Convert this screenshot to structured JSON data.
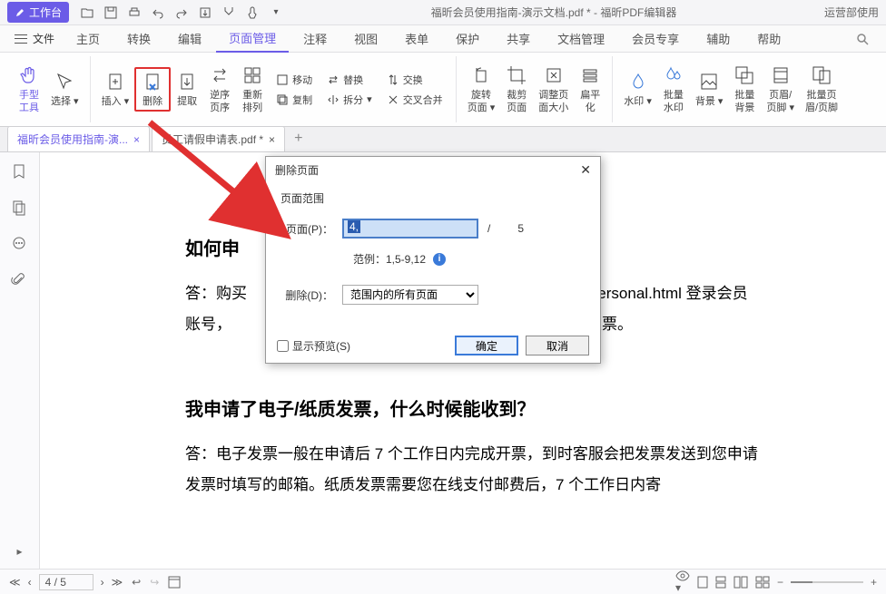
{
  "titlebar": {
    "workspace": "工作台",
    "document_title": "福昕会员使用指南-演示文档.pdf * - 福昕PDF编辑器",
    "right_text": "运营部使用"
  },
  "menu": {
    "file": "文件",
    "items": [
      "主页",
      "转换",
      "编辑",
      "页面管理",
      "注释",
      "视图",
      "表单",
      "保护",
      "共享",
      "文档管理",
      "会员专享",
      "辅助",
      "帮助"
    ],
    "active_index": 3
  },
  "ribbon": {
    "hand_tool": "手型\n工具",
    "select": "选择",
    "insert": "插入",
    "delete": "删除",
    "extract": "提取",
    "reverse": "逆序\n页序",
    "rearrange": "重新\n排列",
    "move": "移动",
    "replace": "替换",
    "swap": "交换",
    "copy": "复制",
    "split": "拆分",
    "merge": "交叉合并",
    "rotate": "旋转\n页面",
    "crop": "裁剪\n页面",
    "resize": "调整页\n面大小",
    "flatten": "扁平\n化",
    "watermark": "水印",
    "batch_watermark": "批量\n水印",
    "background": "背景",
    "batch_background": "批量\n背景",
    "header_footer": "页眉/\n页脚",
    "batch_header_footer": "批量页\n眉/页脚"
  },
  "tabs": {
    "tab1": "福昕会员使用指南-演...",
    "tab2": "员工请假申请表.pdf *"
  },
  "document": {
    "heading1": "如何申",
    "paragraph1_a": "答：购买",
    "paragraph1_b": "e.cn/personal.html 登录会员账号，",
    "paragraph1_c": "申请开发票。",
    "heading2": "我申请了电子/纸质发票，什么时候能收到？",
    "paragraph2": "答：电子发票一般在申请后 7 个工作日内完成开票，到时客服会把发票发送到您申请发票时填写的邮箱。纸质发票需要您在线支付邮费后，7 个工作日内寄"
  },
  "dialog": {
    "title": "删除页面",
    "section": "页面范围",
    "page_label": "页面(P)：",
    "page_value": "4,",
    "slash": "/",
    "total_pages": "5",
    "example_label": "范例：1,5-9,12",
    "delete_label": "删除(D)：",
    "delete_option": "范围内的所有页面",
    "show_preview": "显示预览(S)",
    "ok": "确定",
    "cancel": "取消"
  },
  "statusbar": {
    "page_display": "4 / 5"
  }
}
